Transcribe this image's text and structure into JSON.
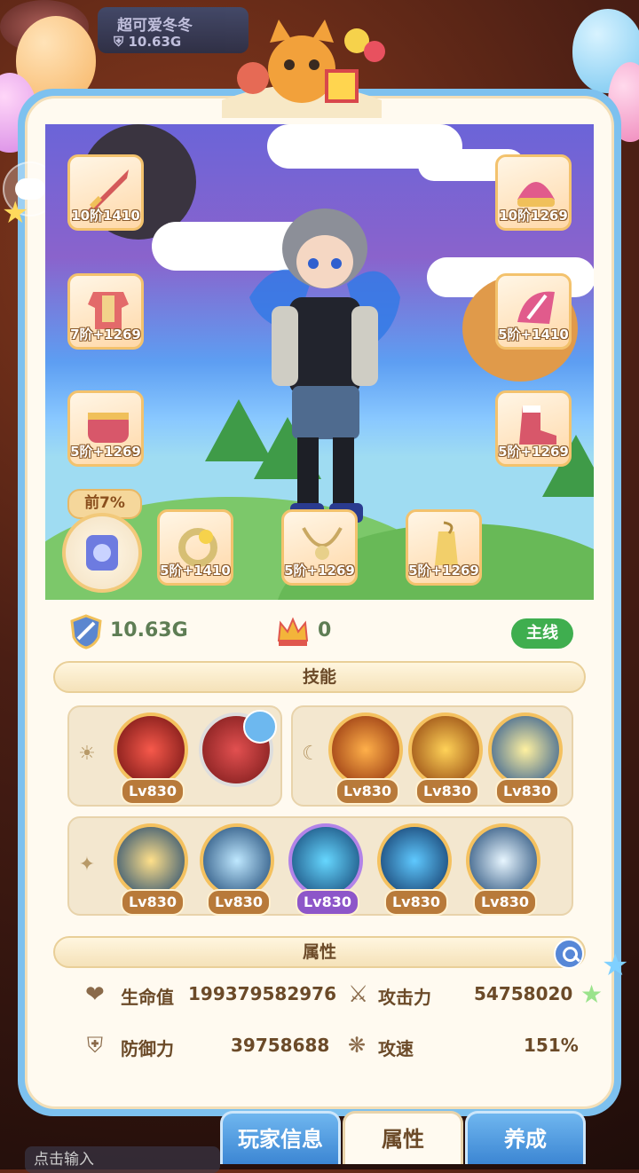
{
  "hud": {
    "player_name": "超可爱冬冬",
    "player_power": "10.63G"
  },
  "equipment": [
    {
      "slot": "weapon",
      "level": "10阶1410"
    },
    {
      "slot": "helmet",
      "level": "10阶1269"
    },
    {
      "slot": "armor",
      "level": "7阶+1269"
    },
    {
      "slot": "shoulder",
      "level": "5阶+1410"
    },
    {
      "slot": "belt",
      "level": "5阶+1269"
    },
    {
      "slot": "boots",
      "level": "5阶+1269"
    },
    {
      "slot": "ring",
      "level": "5阶+1410"
    },
    {
      "slot": "necklace",
      "level": "5阶+1269"
    },
    {
      "slot": "charm",
      "level": "5阶+1269"
    }
  ],
  "pet": {
    "badge": "前7%"
  },
  "stats": {
    "combat_power": "10.63G",
    "crown_count": "0",
    "mainline_label": "主线"
  },
  "skills": {
    "header": "技能",
    "active_group_1": [
      "Lv830"
    ],
    "active_group_2": [
      "Lv830",
      "Lv830",
      "Lv830"
    ],
    "passive_group": [
      "Lv830",
      "Lv830",
      "Lv830",
      "Lv830",
      "Lv830"
    ]
  },
  "attributes": {
    "header": "属性",
    "hp_label": "生命值",
    "hp_value": "199379582976",
    "atk_label": "攻击力",
    "atk_value": "54758020",
    "def_label": "防御力",
    "def_value": "39758688",
    "spd_label": "攻速",
    "spd_value": "151%"
  },
  "tabs": [
    "玩家信息",
    "属性",
    "养成"
  ],
  "input": {
    "placeholder": "点击输入"
  },
  "colors": {
    "accent_blue": "#3c86d3",
    "gold": "#f4c15f",
    "green": "#3fae4f"
  }
}
